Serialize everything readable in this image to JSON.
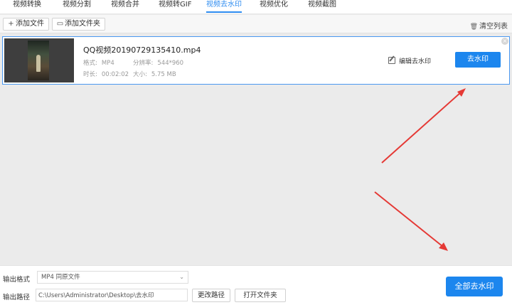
{
  "tabs": [
    {
      "label": "视频转换",
      "active": false
    },
    {
      "label": "视频分割",
      "active": false
    },
    {
      "label": "视频合并",
      "active": false
    },
    {
      "label": "视频转GIF",
      "active": false
    },
    {
      "label": "视频去水印",
      "active": true
    },
    {
      "label": "视频优化",
      "active": false
    },
    {
      "label": "视频截图",
      "active": false
    }
  ],
  "toolbar": {
    "add_file_label": "添加文件",
    "add_folder_label": "添加文件夹",
    "clear_list_label": "清空列表"
  },
  "file": {
    "name": "QQ视频20190729135410.mp4",
    "format_label": "格式:",
    "format_value": "MP4",
    "resolution_label": "分辨率:",
    "resolution_value": "544*960",
    "duration_label": "时长:",
    "duration_value": "00:02:02",
    "size_label": "大小:",
    "size_value": "5.75 MB",
    "edit_watermark_label": "编辑去水印",
    "remove_watermark_label": "去水印"
  },
  "output": {
    "format_label": "输出格式",
    "format_value": "MP4  同原文件",
    "path_label": "输出路径",
    "path_value": "C:\\Users\\Administrator\\Desktop\\去水印",
    "change_path_label": "更改路径",
    "open_folder_label": "打开文件夹",
    "remove_all_label": "全部去水印"
  },
  "colors": {
    "accent": "#1c86ee",
    "annotation_arrow": "#e53935"
  }
}
